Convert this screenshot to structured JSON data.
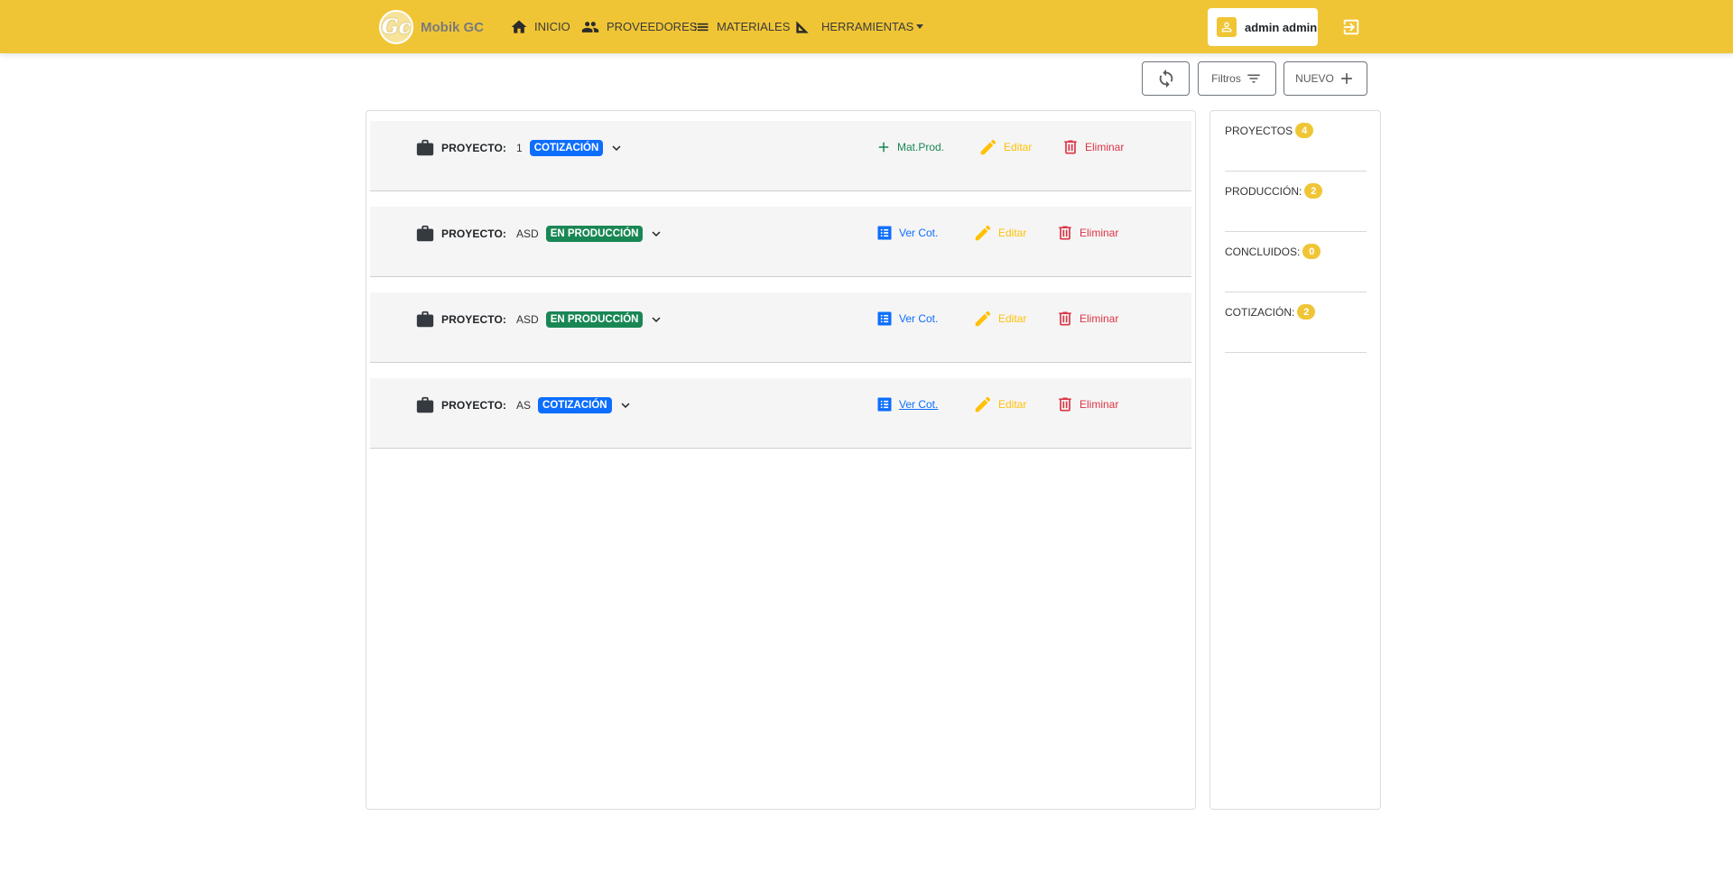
{
  "nav": {
    "brand_glyph": "Gc",
    "brand_name": "Mobik GC",
    "items": [
      {
        "label": "INICIO",
        "icon": "home-icon"
      },
      {
        "label": "PROVEEDORES",
        "icon": "people-icon"
      },
      {
        "label": "MATERIALES",
        "icon": "list-icon"
      },
      {
        "label": "HERRAMIENTAS",
        "icon": "set-square-icon"
      }
    ],
    "user_name": "admin admin",
    "logout_icon": "logout-icon"
  },
  "toolbar": {
    "refresh_icon": "refresh-icon",
    "filter_label": "Filtros",
    "new_label": "NUEVO"
  },
  "projects": [
    {
      "label": "PROYECTO:",
      "name": "1",
      "status": "COTIZACIÓN",
      "status_color": "#0d6efd",
      "first_action": "Mat.Prod.",
      "edit": "Editar",
      "delete": "Eliminar"
    },
    {
      "label": "PROYECTO:",
      "name": "ASD",
      "status": "EN PRODUCCIÓN",
      "status_color": "#198754",
      "first_action": "Ver Cot.",
      "edit": "Editar",
      "delete": "Eliminar"
    },
    {
      "label": "PROYECTO:",
      "name": "ASD",
      "status": "EN PRODUCCIÓN",
      "status_color": "#198754",
      "first_action": "Ver Cot.",
      "edit": "Editar",
      "delete": "Eliminar"
    },
    {
      "label": "PROYECTO:",
      "name": "AS",
      "status": "COTIZACIÓN",
      "status_color": "#0d6efd",
      "first_action": "Ver Cot.",
      "edit": "Editar",
      "delete": "Eliminar"
    }
  ],
  "stats": [
    {
      "label": "PROYECTOS",
      "count": "4"
    },
    {
      "label": "PRODUCCIÓN:",
      "count": "2"
    },
    {
      "label": "CONCLUIDOS:",
      "count": "0"
    },
    {
      "label": "COTIZACIÓN:",
      "count": "2"
    }
  ],
  "colors": {
    "navbar": "#f0c535",
    "accent_blue": "#0d6efd",
    "accent_green": "#198754",
    "accent_amber": "#ffc107",
    "accent_red": "#dc3545"
  }
}
